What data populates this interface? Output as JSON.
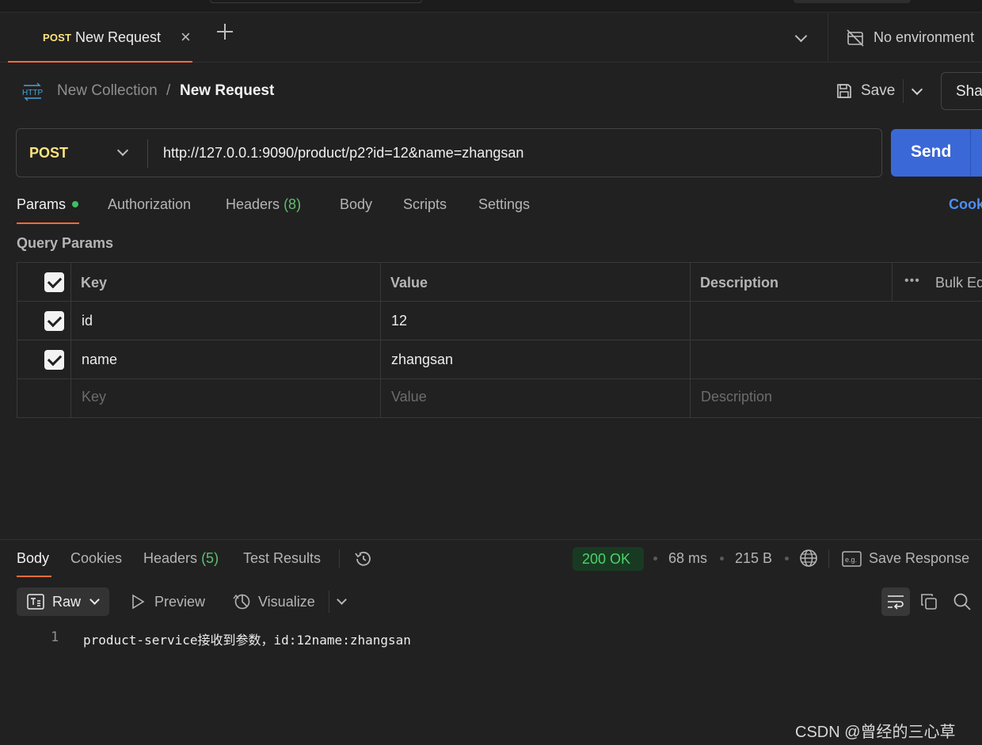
{
  "tab": {
    "method": "POST",
    "title": "New Request",
    "close": "×"
  },
  "environment": {
    "label": "No environment"
  },
  "breadcrumb": {
    "collection": "New Collection",
    "separator": "/",
    "current": "New Request"
  },
  "actions": {
    "save": "Save",
    "share": "Sha"
  },
  "request": {
    "method": "POST",
    "url": "http://127.0.0.1:9090/product/p2?id=12&name=zhangsan",
    "send": "Send"
  },
  "request_tabs": {
    "params": "Params",
    "authorization": "Authorization",
    "headers": "Headers",
    "headers_count": "(8)",
    "body": "Body",
    "scripts": "Scripts",
    "settings": "Settings",
    "cookies": "Cook"
  },
  "query_params": {
    "label": "Query Params",
    "columns": {
      "key": "Key",
      "value": "Value",
      "description": "Description",
      "bulk_edit": "Bulk Ed"
    },
    "rows": [
      {
        "key": "id",
        "value": "12",
        "description": ""
      },
      {
        "key": "name",
        "value": "zhangsan",
        "description": ""
      }
    ],
    "placeholder": {
      "key": "Key",
      "value": "Value",
      "description": "Description"
    }
  },
  "response": {
    "tabs": {
      "body": "Body",
      "cookies": "Cookies",
      "headers": "Headers",
      "headers_count": "(5)",
      "test_results": "Test Results"
    },
    "status": "200 OK",
    "time": "68 ms",
    "size": "215 B",
    "save_response": "Save Response",
    "format": "Raw",
    "preview": "Preview",
    "visualize": "Visualize",
    "lines": [
      {
        "num": "1",
        "text": "product-service接收到参数，id:12name:zhangsan"
      }
    ]
  },
  "watermark": "CSDN @曾经的三心草",
  "colors": {
    "accent": "#ff6c37",
    "post": "#ffe47e",
    "send": "#3a68d6",
    "ok": "#4cd26a"
  }
}
